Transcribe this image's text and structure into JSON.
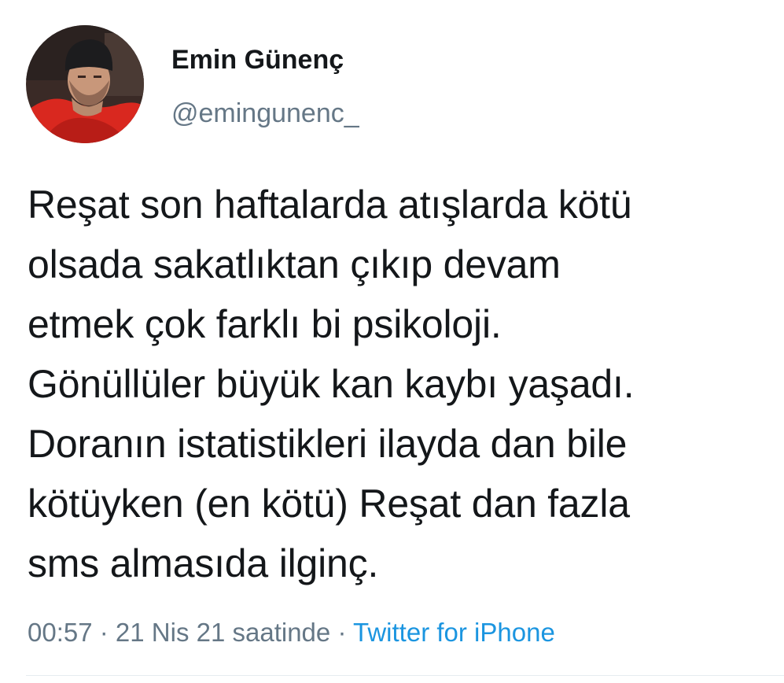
{
  "author": {
    "display_name": "Emin Günenç",
    "handle": "@emingunenc_",
    "avatar_icon": "profile-photo-icon"
  },
  "tweet": {
    "text": "Reşat son haftalarda atışlarda kötü\nolsada sakatlıktan çıkıp devam\netmek çok farklı bi psikoloji.\nGönüllüler büyük kan kaybı yaşadı.\nDoranın istatistikleri ilayda dan bile\nkötüyken (en kötü) Reşat dan fazla\nsms almasıda ilginç."
  },
  "meta": {
    "time": "00:57",
    "sep1": " · ",
    "date": "21 Nis 21 saatinde",
    "sep2": " · ",
    "source": "Twitter for iPhone"
  },
  "colors": {
    "text": "#14171a",
    "secondary": "#657786",
    "link": "#1b95e0"
  }
}
